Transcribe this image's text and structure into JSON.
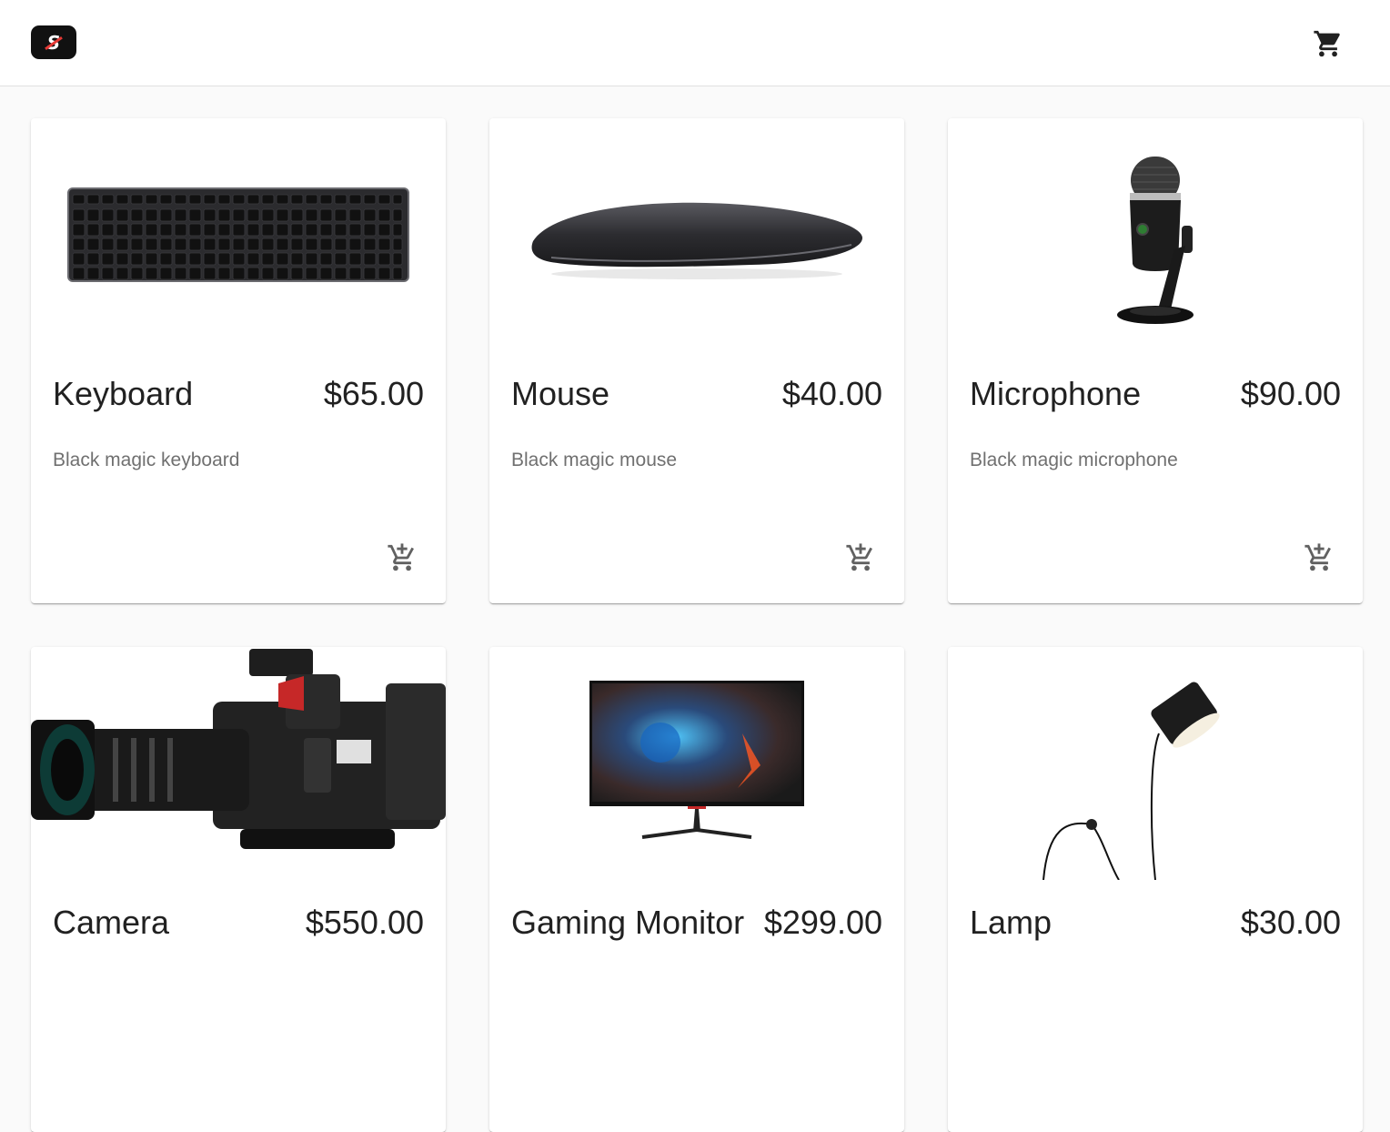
{
  "header": {
    "logo_text": "S",
    "cart_icon": "shopping-cart-icon"
  },
  "products": [
    {
      "name": "Keyboard",
      "price": "$65.00",
      "description": "Black magic keyboard",
      "image": "keyboard-image"
    },
    {
      "name": "Mouse",
      "price": "$40.00",
      "description": "Black magic mouse",
      "image": "mouse-image"
    },
    {
      "name": "Microphone",
      "price": "$90.00",
      "description": "Black magic microphone",
      "image": "microphone-image"
    },
    {
      "name": "Camera",
      "price": "$550.00",
      "description": "",
      "image": "camera-image"
    },
    {
      "name": "Gaming Monitor",
      "price": "$299.00",
      "description": "",
      "image": "monitor-image"
    },
    {
      "name": "Lamp",
      "price": "$30.00",
      "description": "",
      "image": "lamp-image"
    }
  ],
  "colors": {
    "background": "#fafafa",
    "card": "#ffffff",
    "text": "#212121",
    "muted": "#707070",
    "icon": "#616161"
  }
}
